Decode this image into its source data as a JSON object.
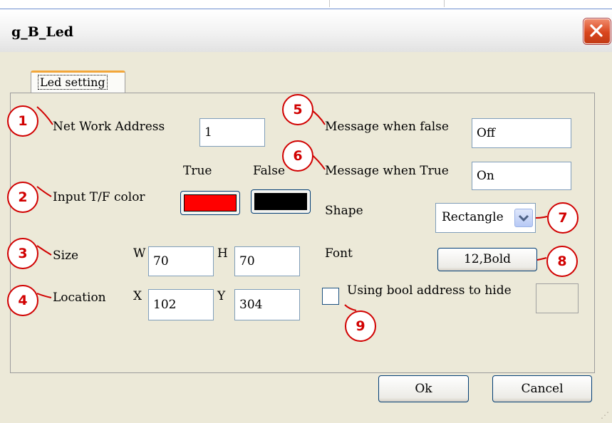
{
  "window": {
    "title": "g_B_Led"
  },
  "tab": {
    "label": "Led setting"
  },
  "fields": {
    "network_address": {
      "label": "Net Work Address",
      "value": "1"
    },
    "input_color": {
      "label": "Input T/F color",
      "true_label": "True",
      "false_label": "False",
      "true_color": "#ff0000",
      "false_color": "#000000"
    },
    "size": {
      "label": "Size",
      "w_label": "W",
      "w_value": "70",
      "h_label": "H",
      "h_value": "70"
    },
    "location": {
      "label": "Location",
      "x_label": "X",
      "x_value": "102",
      "y_label": "Y",
      "y_value": "304"
    },
    "message_false": {
      "label": "Message when false",
      "value": "Off"
    },
    "message_true": {
      "label": "Message when True",
      "value": "On"
    },
    "shape": {
      "label": "Shape",
      "value": "Rectangle"
    },
    "font": {
      "label": "Font",
      "value": "12,Bold"
    },
    "hide": {
      "label": "Using bool address to hide",
      "checked": false
    }
  },
  "buttons": {
    "ok": "Ok",
    "cancel": "Cancel"
  },
  "markers": [
    "1",
    "2",
    "3",
    "4",
    "5",
    "6",
    "7",
    "8",
    "9"
  ],
  "colors": {
    "marker": "#d10000",
    "close": "#d9461e",
    "tab_accent": "#f2a63a"
  }
}
